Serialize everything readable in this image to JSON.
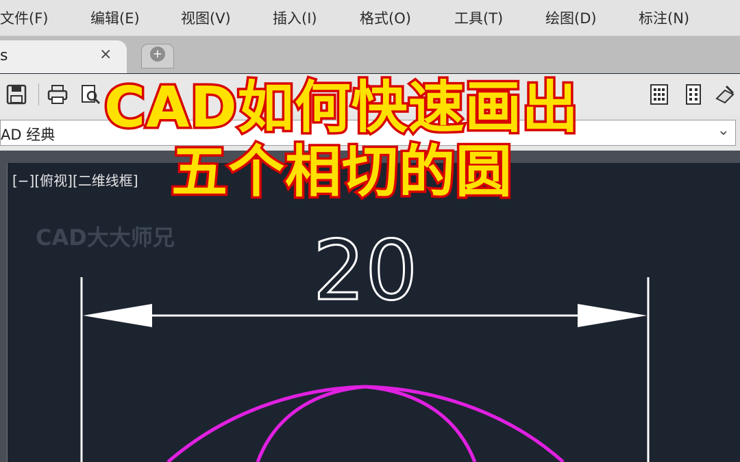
{
  "menu": [
    "文件(F)",
    "编辑(E)",
    "视图(V)",
    "插入(I)",
    "格式(O)",
    "工具(T)",
    "绘图(D)",
    "标注(N)"
  ],
  "tab": {
    "label": "s",
    "close": "×",
    "new_tab": "+"
  },
  "workspace": {
    "selected": "AD 经典"
  },
  "viewport": {
    "label": "[−][俯视][二维线框]",
    "watermark": "CAD大大师兄"
  },
  "dimension": {
    "value": "20"
  },
  "overlay_title": {
    "line1": "CAD如何快速画出",
    "line2": "五个相切的圆"
  },
  "colors": {
    "circle": "#e020e0",
    "dimension": "#ffffff",
    "title_fill": "#ffe100",
    "title_stroke": "#d80000",
    "viewport_bg": "#1c2430"
  }
}
